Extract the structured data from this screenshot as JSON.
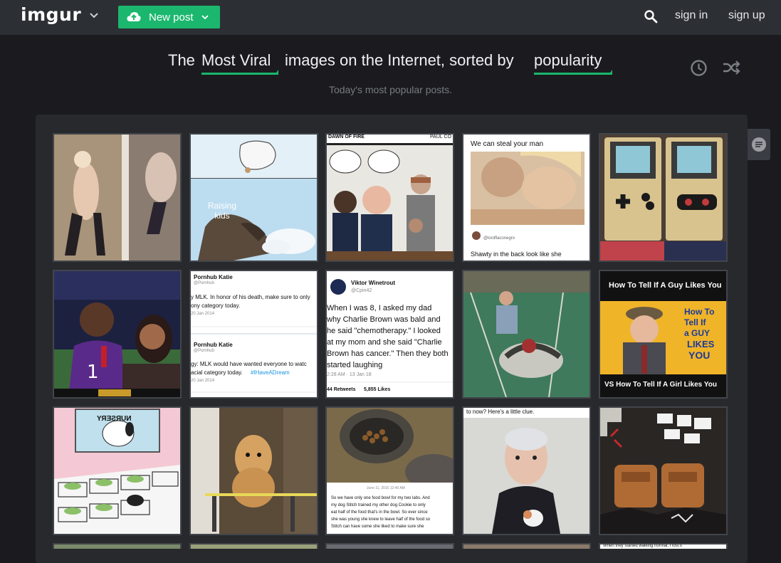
{
  "header": {
    "logo": "imgur",
    "new_post_label": "New post",
    "sign_in": "sign in",
    "sign_up": "sign up"
  },
  "headline": {
    "prefix": "The",
    "section": "Most Viral",
    "middle": "images on the Internet, sorted by",
    "sort": "popularity",
    "subtitle": "Today's most popular posts."
  },
  "icons": [
    "chevron-down-icon",
    "upload-cloud-icon",
    "search-icon",
    "clock-icon",
    "shuffle-icon",
    "comment-icon"
  ],
  "colors": {
    "accent": "#1bb76e",
    "topbar": "#2c2f34",
    "background": "#1b1b1f",
    "panel": "#27292d"
  },
  "tiles": [
    {
      "name": "tile-photo-outdoor"
    },
    {
      "name": "tile-raising-kids-comic",
      "text": "Raising kids"
    },
    {
      "name": "tile-dawn-fire-comic",
      "text_a": "DAWN OF FIRE",
      "text_b": "PAUL CO"
    },
    {
      "name": "tile-we-can-steal-your-man",
      "top": "We can steal your man",
      "handle": "@lordflaconegro",
      "bottom": "Shawty in the back look like she"
    },
    {
      "name": "tile-gameboy-consoles"
    },
    {
      "name": "tile-stadium-interview"
    },
    {
      "name": "tile-pornhub-katie-tweets",
      "user": "Pornhub Katie",
      "handle": "@Pornhub",
      "l1": "y MLK. In honor of his death, make sure to only",
      "l2": "ony category today.",
      "d1": "20 Jan 2014",
      "user2": "Pornhub Katie",
      "handle2": "@Pornhub",
      "l3": "gy: MLK would have wanted everyone to watc",
      "l4": "acial category today.",
      "tag": "#IHaveADream",
      "d2": "20 Jan 2014"
    },
    {
      "name": "tile-viktor-winetrout-tweet",
      "user": "Viktor Winetrout",
      "handle": "@Cpin42",
      "l1": "When I was 8, I asked my dad",
      "l2": "why Charlie Brown was bald and",
      "l3": "he said \"chemotherapy.\" I looked",
      "l4": "at my mom and she said \"Charlie",
      "l5": "Brown has cancer.\" Then they both",
      "l6": "started laughing",
      "time": "2:28 AM · 13 Jan 18",
      "retweets": "44 Retweets",
      "likes": "5,855 Likes"
    },
    {
      "name": "tile-man-with-turkey"
    },
    {
      "name": "tile-how-to-tell-guy-likes-you",
      "top": "How To Tell If A Guy Likes You",
      "right": [
        "How To",
        "Tell If",
        "a GUY",
        "LIKES",
        "YOU"
      ],
      "bottom": "VS How To Tell If A Girl Likes You"
    },
    {
      "name": "tile-snoopy-nursery",
      "text": "NURSERY"
    },
    {
      "name": "tile-golden-retriever"
    },
    {
      "name": "tile-dog-food-bowl",
      "date": "June 11, 2015 12:40 AM",
      "t1": "So we have only one food bowl for my two labs. And",
      "t2": "my dog Stitch trained my other dog Cookie to only",
      "t3": "eat half of the food that's in the bowl. So ever since",
      "t4": "she was young she knew to leave half of the food so",
      "t5": "Stitch can have some she liked to make sure she"
    },
    {
      "name": "tile-sophia-robot",
      "top": "to now? Here's a little clue."
    },
    {
      "name": "tile-backpacks-flatlay"
    }
  ],
  "bottom_peek_text": "When they started walking normal, I lost it"
}
